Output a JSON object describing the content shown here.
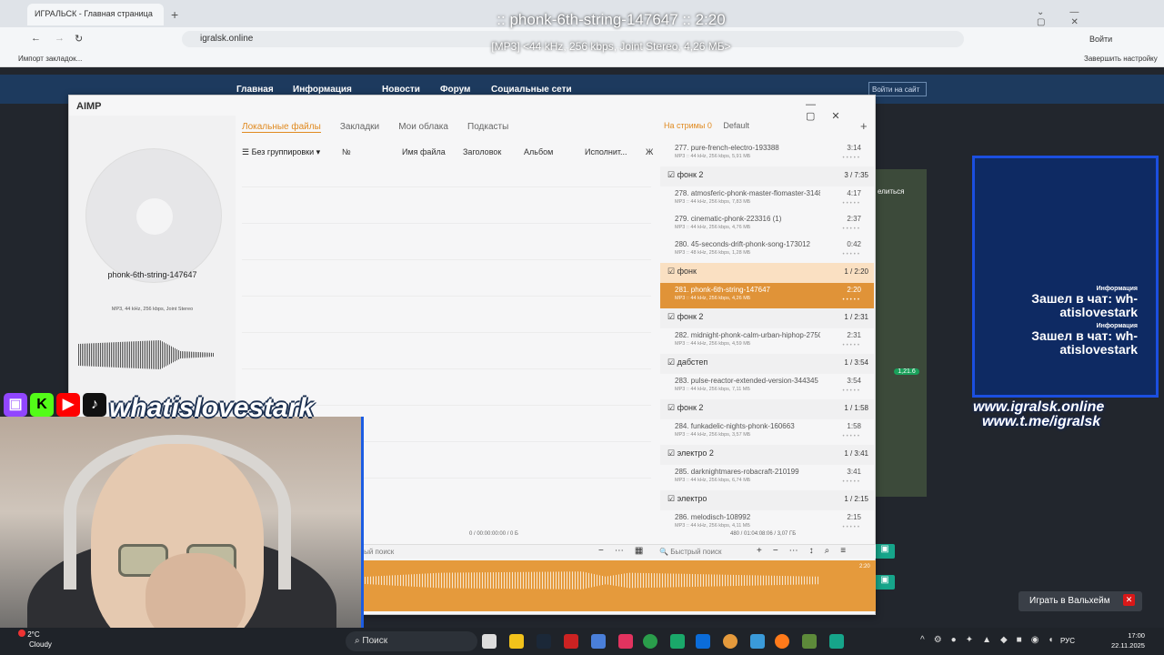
{
  "browser": {
    "tab_title": "ИГРАЛЬСК - Главная страница",
    "url": "igralsk.online",
    "bookmark": "Импорт закладок...",
    "profile": "Войти",
    "finish_setup": "Завершить настройку"
  },
  "overlay": {
    "track_title": ":: phonk-6th-string-147647 :: 2:20",
    "track_info": "[MP3] <44 kHz, 256 kbps, Joint Stereo, 4,26 МБ>"
  },
  "site": {
    "nav": [
      "Главная",
      "Информация",
      "Новости",
      "Форум",
      "Социальные сети"
    ],
    "login": "Войти на сайт"
  },
  "aimp": {
    "logo": "AIMP",
    "album_name": "phonk-6th-string-147647",
    "format": "MP3, 44 kHz, 256 kbps, Joint Stereo",
    "tabs": [
      "Локальные файлы",
      "Закладки",
      "Мои облака",
      "Подкасты"
    ],
    "grouping": "Без группировки",
    "columns": [
      "№",
      "Имя файла",
      "Заголовок",
      "Альбом",
      "Исполнит...",
      "Ж"
    ],
    "playlist_tabs": [
      "На стримы 0",
      "Default"
    ],
    "status_left": "0 / 00:00:00:00 / 0 Б",
    "status_right": "480 / 01:04:08:06 / 3,07 ГБ",
    "quick_search_left": "стрый поиск",
    "quick_search_right": "Быстрый поиск",
    "elapsed": "2:20"
  },
  "playlist": [
    {
      "kind": "track",
      "title": "277. pure-french-electro-193388",
      "meta": "MP3 :: 44 kHz, 256 kbps, 5,91 МБ",
      "dur": "3:14"
    },
    {
      "kind": "group",
      "name": "фонк 2",
      "info": "3 / 7:35"
    },
    {
      "kind": "track",
      "title": "278. atmosferic-phonk-master-flomaster-314851",
      "meta": "MP3 :: 44 kHz, 256 kbps, 7,83 МБ",
      "dur": "4:17"
    },
    {
      "kind": "track",
      "title": "279. cinematic-phonk-223316 (1)",
      "meta": "MP3 :: 44 kHz, 256 kbps, 4,76 МБ",
      "dur": "2:37"
    },
    {
      "kind": "track",
      "title": "280. 45-seconds-drift-phonk-song-173012",
      "meta": "MP3 :: 48 kHz, 256 kbps, 1,28 МБ",
      "dur": "0:42"
    },
    {
      "kind": "group",
      "name": "фонк",
      "info": "1 / 2:20",
      "hot": true
    },
    {
      "kind": "track",
      "title": "281. phonk-6th-string-147647",
      "meta": "MP3 :: 44 kHz, 256 kbps, 4,26 МБ",
      "dur": "2:20",
      "selected": true
    },
    {
      "kind": "group",
      "name": "фонк 2",
      "info": "1 / 2:31"
    },
    {
      "kind": "track",
      "title": "282. midnight-phonk-calm-urban-hiphop-275054",
      "meta": "MP3 :: 44 kHz, 256 kbps, 4,59 МБ",
      "dur": "2:31"
    },
    {
      "kind": "group",
      "name": "дабстеп",
      "info": "1 / 3:54"
    },
    {
      "kind": "track",
      "title": "283. pulse-reactor-extended-version-344345",
      "meta": "MP3 :: 44 kHz, 256 kbps, 7,11 МБ",
      "dur": "3:54"
    },
    {
      "kind": "group",
      "name": "фонк 2",
      "info": "1 / 1:58"
    },
    {
      "kind": "track",
      "title": "284. funkadelic-nights-phonk-160663",
      "meta": "MP3 :: 44 kHz, 256 kbps, 3,57 МБ",
      "dur": "1:58"
    },
    {
      "kind": "group",
      "name": "электро 2",
      "info": "1 / 3:41"
    },
    {
      "kind": "track",
      "title": "285. darknightmares-robacraft-210199",
      "meta": "MP3 :: 44 kHz, 256 kbps, 6,74 МБ",
      "dur": "3:41"
    },
    {
      "kind": "group",
      "name": "электро",
      "info": "1 / 2:15"
    },
    {
      "kind": "track",
      "title": "286. melodisch-108992",
      "meta": "MP3 :: 44 kHz, 256 kbps, 4,11 МБ",
      "dur": "2:15"
    }
  ],
  "chat": {
    "label1": "Информация",
    "msg1": "Зашел в чат: wh-atislovestark",
    "label2": "Информация",
    "msg2": "Зашел в чат: wh-atislovestark"
  },
  "promo": {
    "line1": "www.igralsk.online",
    "line2": "www.t.me/igralsk"
  },
  "game_text": "елиться",
  "game_badge": "1,21.6",
  "stream_brand": "whatislovestark",
  "valheim_button": "Играть в Вальхейм",
  "valheim_close": "✕",
  "taskbar": {
    "weather_temp": "2°C",
    "weather": "Cloudy",
    "search": "Поиск",
    "lang": "РУС",
    "time": "17:00",
    "date": "22.11.2025"
  },
  "colors": {
    "accent": "#e59a3c",
    "blue_frame": "#1b4fe0"
  }
}
